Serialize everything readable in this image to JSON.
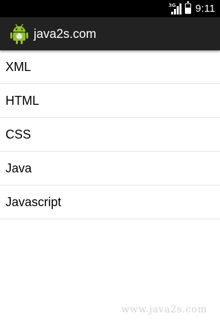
{
  "status_bar": {
    "network_type": "3G",
    "time": "9:11",
    "icons": [
      "signal-icon",
      "battery-icon"
    ]
  },
  "action_bar": {
    "app_icon": "android-icon",
    "title": "java2s.com",
    "background_color": "#222222"
  },
  "list": {
    "items": [
      {
        "label": "XML"
      },
      {
        "label": "HTML"
      },
      {
        "label": "CSS"
      },
      {
        "label": "Java"
      },
      {
        "label": "Javascript"
      }
    ]
  },
  "watermark": {
    "text": "www.java2s.com"
  }
}
